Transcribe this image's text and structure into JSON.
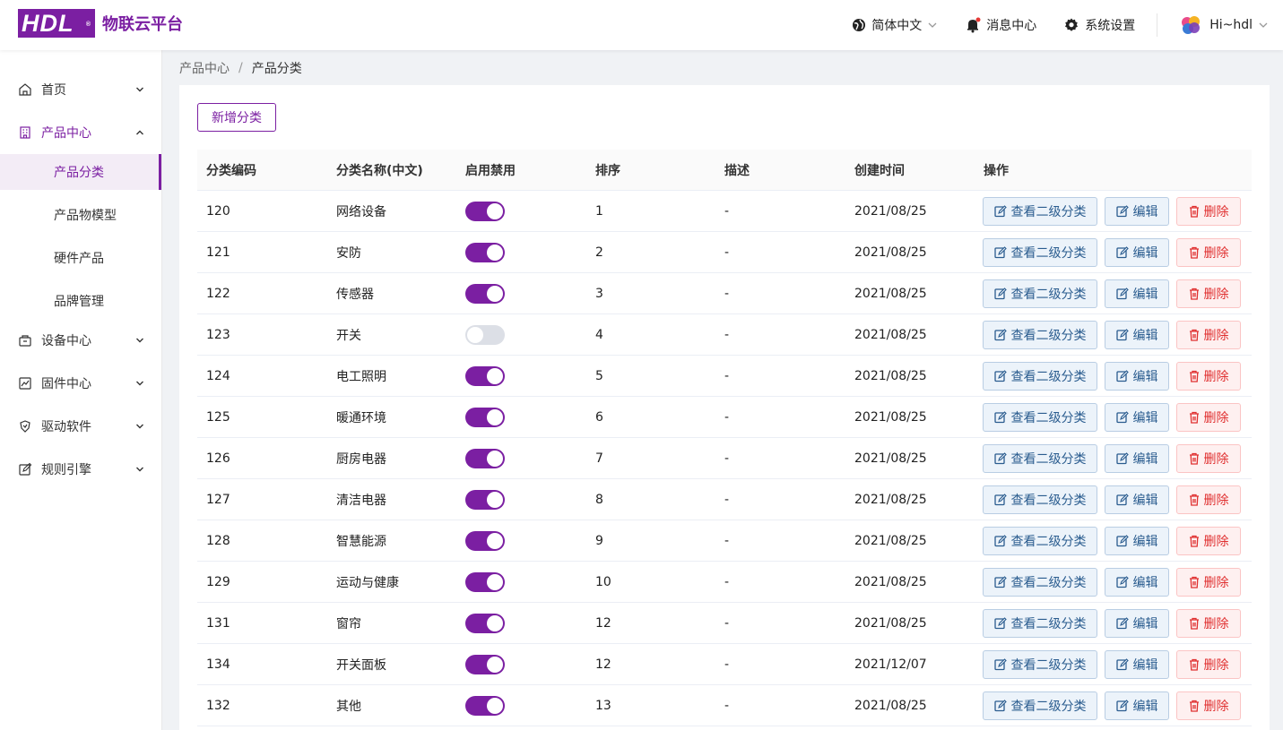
{
  "brand": {
    "logo_text": "HDL",
    "reg": "®",
    "platform_name": "物联云平台"
  },
  "header": {
    "language": "简体中文",
    "messages": "消息中心",
    "settings": "系统设置",
    "user": "Hi~hdl"
  },
  "sidebar": {
    "home": "首页",
    "product_center": "产品中心",
    "product_sub": [
      "产品分类",
      "产品物模型",
      "硬件产品",
      "品牌管理"
    ],
    "device_center": "设备中心",
    "firmware_center": "固件中心",
    "driver_software": "驱动软件",
    "rule_engine": "规则引擎"
  },
  "breadcrumb": {
    "parent": "产品中心",
    "separator": "/",
    "current": "产品分类"
  },
  "toolbar": {
    "add_label": "新增分类"
  },
  "table": {
    "headers": [
      "分类编码",
      "分类名称(中文)",
      "启用禁用",
      "排序",
      "描述",
      "创建时间",
      "操作"
    ],
    "actions": {
      "view": "查看二级分类",
      "edit": "编辑",
      "delete": "删除"
    },
    "rows": [
      {
        "code": "120",
        "name": "网络设备",
        "enabled": true,
        "sort": "1",
        "desc": "-",
        "created": "2021/08/25"
      },
      {
        "code": "121",
        "name": "安防",
        "enabled": true,
        "sort": "2",
        "desc": "-",
        "created": "2021/08/25"
      },
      {
        "code": "122",
        "name": "传感器",
        "enabled": true,
        "sort": "3",
        "desc": "-",
        "created": "2021/08/25"
      },
      {
        "code": "123",
        "name": "开关",
        "enabled": false,
        "sort": "4",
        "desc": "-",
        "created": "2021/08/25"
      },
      {
        "code": "124",
        "name": "电工照明",
        "enabled": true,
        "sort": "5",
        "desc": "-",
        "created": "2021/08/25"
      },
      {
        "code": "125",
        "name": "暖通环境",
        "enabled": true,
        "sort": "6",
        "desc": "-",
        "created": "2021/08/25"
      },
      {
        "code": "126",
        "name": "厨房电器",
        "enabled": true,
        "sort": "7",
        "desc": "-",
        "created": "2021/08/25"
      },
      {
        "code": "127",
        "name": "清洁电器",
        "enabled": true,
        "sort": "8",
        "desc": "-",
        "created": "2021/08/25"
      },
      {
        "code": "128",
        "name": "智慧能源",
        "enabled": true,
        "sort": "9",
        "desc": "-",
        "created": "2021/08/25"
      },
      {
        "code": "129",
        "name": "运动与健康",
        "enabled": true,
        "sort": "10",
        "desc": "-",
        "created": "2021/08/25"
      },
      {
        "code": "131",
        "name": "窗帘",
        "enabled": true,
        "sort": "12",
        "desc": "-",
        "created": "2021/08/25"
      },
      {
        "code": "134",
        "name": "开关面板",
        "enabled": true,
        "sort": "12",
        "desc": "-",
        "created": "2021/12/07"
      },
      {
        "code": "132",
        "name": "其他",
        "enabled": true,
        "sort": "13",
        "desc": "-",
        "created": "2021/08/25"
      }
    ]
  },
  "colors": {
    "brand": "#7b1fa2",
    "active_bg": "#f3ecf6",
    "danger": "#e03030",
    "link": "#2a5c8f"
  }
}
